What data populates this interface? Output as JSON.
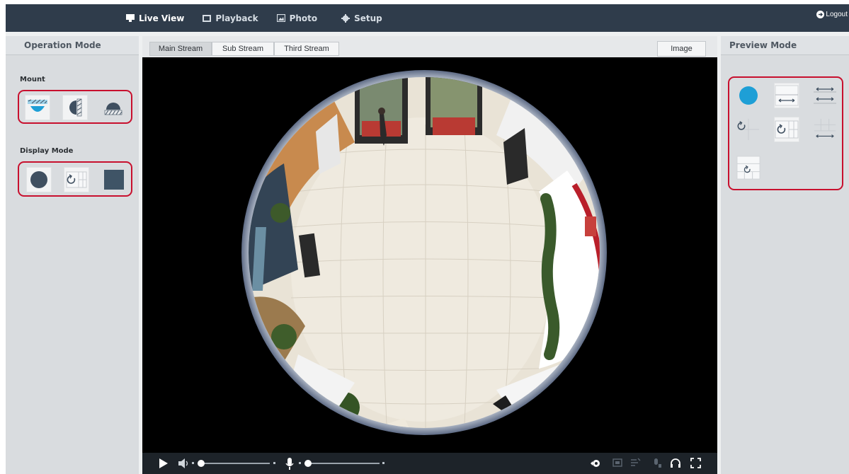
{
  "nav": {
    "live_view": "Live View",
    "playback": "Playback",
    "photo": "Photo",
    "setup": "Setup",
    "logout": "Logout"
  },
  "left_panel": {
    "title": "Operation Mode",
    "mount_label": "Mount",
    "display_mode_label": "Display Mode",
    "mount_options": [
      "ceiling-mount-icon",
      "wall-mount-icon",
      "desktop-mount-icon"
    ],
    "display_options": [
      "fisheye-circle-icon",
      "panorama-grid-icon",
      "full-square-icon"
    ]
  },
  "right_panel": {
    "title": "Preview Mode"
  },
  "streams": {
    "main": "Main Stream",
    "sub": "Sub Stream",
    "third": "Third Stream",
    "active": "Main Stream",
    "image_button": "Image"
  },
  "playback": {
    "volume_level": 0.0,
    "mic_level": 0.0
  },
  "colors": {
    "topbar": "#2f3c4b",
    "accent_blue": "#1e9fd6",
    "highlight_red": "#c8102e",
    "icon_dark": "#3f4f60"
  }
}
